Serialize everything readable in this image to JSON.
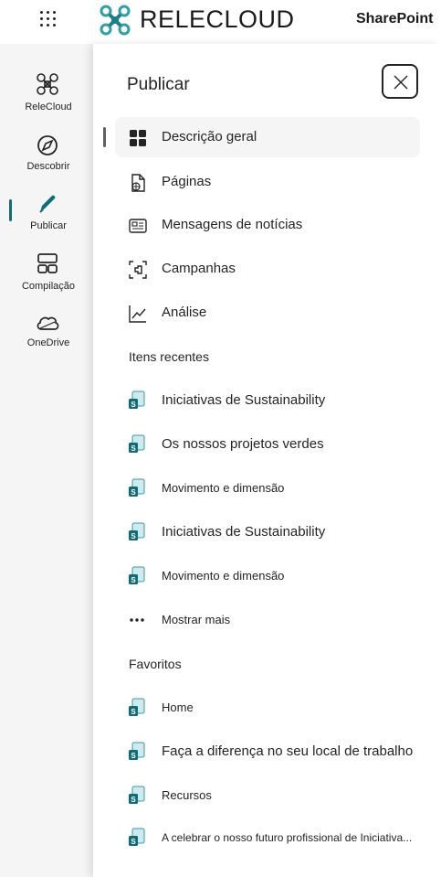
{
  "header": {
    "brand": "RELECLOUD",
    "product": "SharePoint"
  },
  "rail": {
    "items": [
      {
        "label": "ReleCloud",
        "icon": "relecloud-logo-icon"
      },
      {
        "label": "Descobrir",
        "icon": "compass-icon"
      },
      {
        "label": "Publicar",
        "icon": "pen-icon"
      },
      {
        "label": "Compilação",
        "icon": "build-icon"
      },
      {
        "label": "OneDrive",
        "icon": "cloud-icon"
      }
    ]
  },
  "panel": {
    "title": "Publicar",
    "nav": [
      {
        "label": "Descrição geral",
        "icon": "grid-icon"
      },
      {
        "label": "Páginas",
        "icon": "page-globe-icon"
      },
      {
        "label": "Mensagens de notícias",
        "icon": "news-icon"
      },
      {
        "label": "Campanhas",
        "icon": "campaign-icon"
      },
      {
        "label": "Análise",
        "icon": "analytics-icon"
      }
    ],
    "recent_heading": "Itens recentes",
    "recent": [
      "Iniciativas de Sustainability",
      "Os nossos projetos verdes",
      "Movimento e dimensão",
      "Iniciativas de Sustainability",
      "Movimento e dimensão"
    ],
    "show_more": "Mostrar mais",
    "favorites_heading": "Favoritos",
    "favorites": [
      "Home",
      "Faça a diferença no seu local de trabalho",
      "Recursos",
      "A celebrar o nosso futuro profissional de Iniciativa..."
    ]
  },
  "colors": {
    "accent": "#0f6c78",
    "rail_bg": "#f5f5f5"
  }
}
